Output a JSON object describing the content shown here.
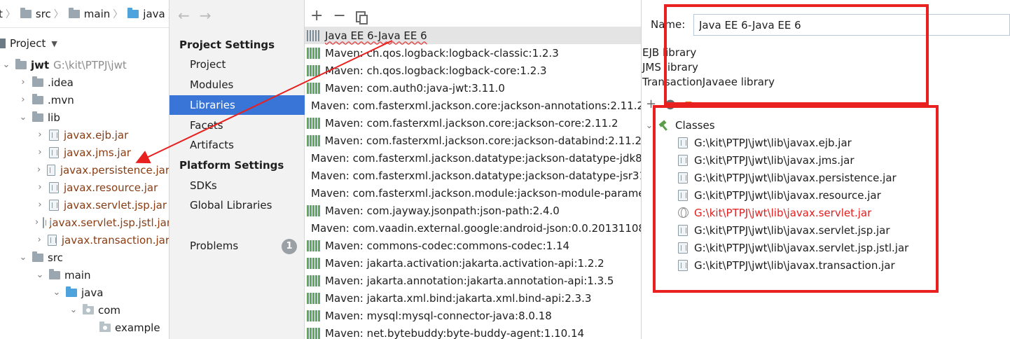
{
  "breadcrumbs": [
    "t",
    "src",
    "main",
    "java"
  ],
  "project_header": "Project",
  "tree": [
    {
      "level": 0,
      "arrow": "v",
      "type": "module",
      "label": "jwt",
      "note": "G:\\kit\\PTPJ\\jwt"
    },
    {
      "level": 1,
      "arrow": ">",
      "type": "folder",
      "label": ".idea"
    },
    {
      "level": 1,
      "arrow": ">",
      "type": "folder",
      "label": ".mvn"
    },
    {
      "level": 1,
      "arrow": "v",
      "type": "folder",
      "label": "lib"
    },
    {
      "level": 2,
      "arrow": ">",
      "type": "jar",
      "label": "javax.ejb.jar"
    },
    {
      "level": 2,
      "arrow": ">",
      "type": "jar",
      "label": "javax.jms.jar"
    },
    {
      "level": 2,
      "arrow": ">",
      "type": "jar",
      "label": "javax.persistence.jar"
    },
    {
      "level": 2,
      "arrow": ">",
      "type": "jar",
      "label": "javax.resource.jar"
    },
    {
      "level": 2,
      "arrow": ">",
      "type": "jar",
      "label": "javax.servlet.jsp.jar"
    },
    {
      "level": 2,
      "arrow": ">",
      "type": "jar",
      "label": "javax.servlet.jsp.jstl.jar"
    },
    {
      "level": 2,
      "arrow": ">",
      "type": "jar",
      "label": "javax.transaction.jar"
    },
    {
      "level": 1,
      "arrow": "v",
      "type": "folder",
      "label": "src"
    },
    {
      "level": 2,
      "arrow": "v",
      "type": "folder",
      "label": "main"
    },
    {
      "level": 3,
      "arrow": "v",
      "type": "blue",
      "label": "java"
    },
    {
      "level": 4,
      "arrow": "v",
      "type": "pkg",
      "label": "com"
    },
    {
      "level": 5,
      "arrow": "",
      "type": "pkg",
      "label": "example"
    }
  ],
  "nav": {
    "project_settings": "Project Settings",
    "items1": [
      "Project",
      "Modules",
      "Libraries",
      "Facets",
      "Artifacts"
    ],
    "selected": "Libraries",
    "platform_settings": "Platform Settings",
    "items2": [
      "SDKs",
      "Global Libraries"
    ],
    "problems": "Problems",
    "problems_count": "1"
  },
  "libraries": [
    "Java EE 6-Java EE 6",
    "Maven: ch.qos.logback:logback-classic:1.2.3",
    "Maven: ch.qos.logback:logback-core:1.2.3",
    "Maven: com.auth0:java-jwt:3.11.0",
    "Maven: com.fasterxml.jackson.core:jackson-annotations:2.11.2",
    "Maven: com.fasterxml.jackson.core:jackson-core:2.11.2",
    "Maven: com.fasterxml.jackson.core:jackson-databind:2.11.2",
    "Maven: com.fasterxml.jackson.datatype:jackson-datatype-jdk8",
    "Maven: com.fasterxml.jackson.datatype:jackson-datatype-jsr31",
    "Maven: com.fasterxml.jackson.module:jackson-module-parame",
    "Maven: com.jayway.jsonpath:json-path:2.4.0",
    "Maven: com.vaadin.external.google:android-json:0.0.20131108",
    "Maven: commons-codec:commons-codec:1.14",
    "Maven: jakarta.activation:jakarta.activation-api:1.2.2",
    "Maven: jakarta.annotation:jakarta.annotation-api:1.3.5",
    "Maven: jakarta.xml.bind:jakarta.xml.bind-api:2.3.3",
    "Maven: mysql:mysql-connector-java:8.0.18",
    "Maven: net.bytebuddy:byte-buddy-agent:1.10.14"
  ],
  "detail": {
    "name_label": "Name:",
    "name_value": "Java EE 6-Java EE 6",
    "kinds": [
      "EJB library",
      "JMS library",
      "TransactionJavaee library"
    ],
    "classes_header": "Classes",
    "classes": [
      {
        "path": "G:\\kit\\PTPJ\\jwt\\lib\\javax.ejb.jar",
        "broken": false
      },
      {
        "path": "G:\\kit\\PTPJ\\jwt\\lib\\javax.jms.jar",
        "broken": false
      },
      {
        "path": "G:\\kit\\PTPJ\\jwt\\lib\\javax.persistence.jar",
        "broken": false
      },
      {
        "path": "G:\\kit\\PTPJ\\jwt\\lib\\javax.resource.jar",
        "broken": false
      },
      {
        "path": "G:\\kit\\PTPJ\\jwt\\lib\\javax.servlet.jar",
        "broken": true
      },
      {
        "path": "G:\\kit\\PTPJ\\jwt\\lib\\javax.servlet.jsp.jar",
        "broken": false
      },
      {
        "path": "G:\\kit\\PTPJ\\jwt\\lib\\javax.servlet.jsp.jstl.jar",
        "broken": false
      },
      {
        "path": "G:\\kit\\PTPJ\\jwt\\lib\\javax.transaction.jar",
        "broken": false
      }
    ]
  },
  "colors": {
    "selection": "#3875d6",
    "annotation": "#e8201f",
    "jar_text": "#8a3c12",
    "broken": "#e02020"
  }
}
